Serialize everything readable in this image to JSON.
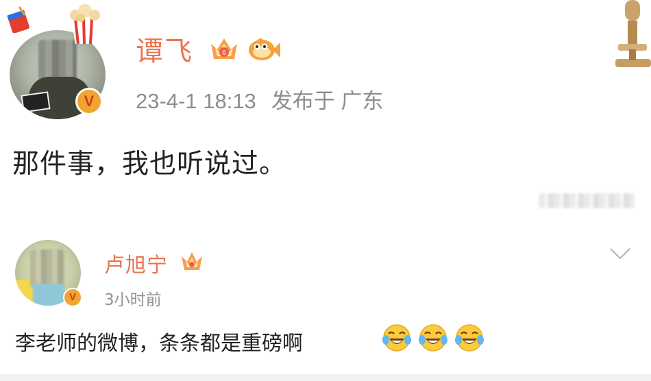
{
  "post": {
    "author": "谭飞",
    "badge_level": "6",
    "timestamp": "23-4-1 18:13",
    "location": "发布于 广东",
    "content": "那件事，我也听说过。",
    "verified_mark": "V"
  },
  "comment": {
    "author": "卢旭宁",
    "time": "3小时前",
    "content": "李老师的微博，条条都是重磅啊",
    "verified_mark": "V",
    "emojis": [
      "laughing-tears-emoji",
      "laughing-tears-emoji",
      "laughing-tears-emoji"
    ]
  },
  "colors": {
    "name_accent": "#eb7350",
    "meta_gray": "#8d8d8d",
    "badge_gold": "#f1a430",
    "badge_red": "#d23b1f"
  }
}
